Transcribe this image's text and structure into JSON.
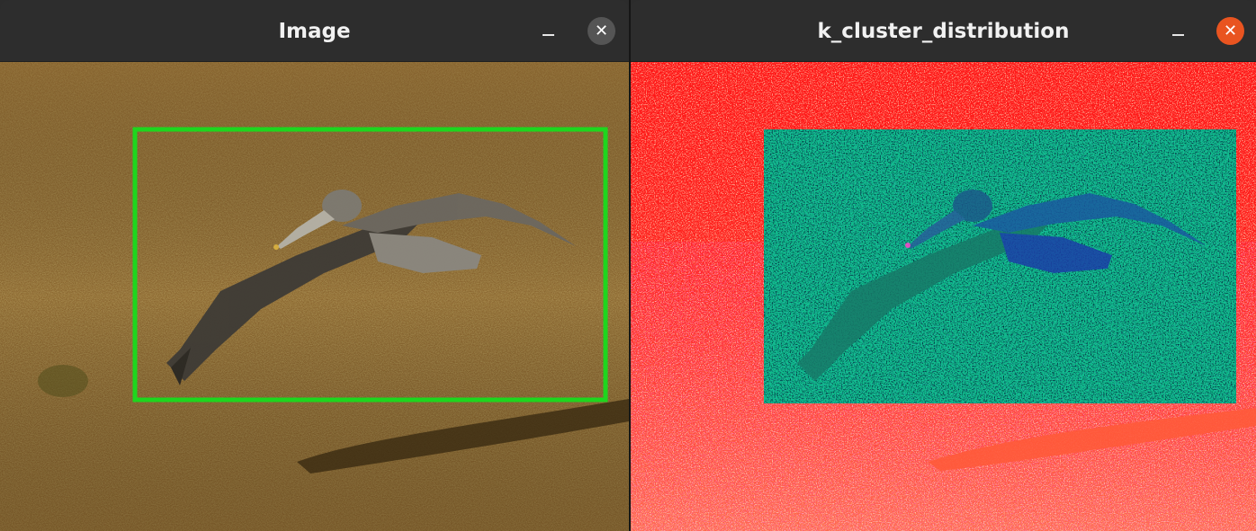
{
  "windows": [
    {
      "title": "Image",
      "minimize_icon": "minimize-icon",
      "close_icon": "close-icon",
      "close_glyph": "✕",
      "colors": {
        "titlebar": "#2d2d2d",
        "close_bg": "#555555",
        "box": "#1ed61e"
      }
    },
    {
      "title": "k_cluster_distribution",
      "minimize_icon": "minimize-icon",
      "close_icon": "close-icon",
      "close_glyph": "✕",
      "colors": {
        "titlebar": "#2d2d2d",
        "close_bg": "#e95420",
        "cluster_box": "#0fc48f"
      }
    }
  ]
}
